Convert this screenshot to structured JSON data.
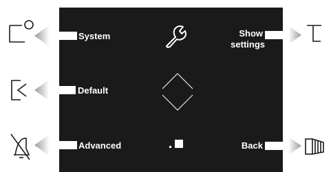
{
  "screen": {
    "background": "#1a1a1a",
    "arrow_color": "#ffffff",
    "left_buttons": [
      {
        "label": "System",
        "icon": "card-corner-circle-icon"
      },
      {
        "label": "Default",
        "icon": "bracket-back-icon"
      },
      {
        "label": "Advanced",
        "icon": "bell-muted-icon"
      }
    ],
    "right_buttons": [
      {
        "label_line1": "Show",
        "label_line2": "settings",
        "icon": "bracket-corner-icon"
      },
      {
        "label": "Back",
        "icon": "cassette-icon"
      }
    ],
    "center_icons": [
      "wrench-icon",
      "diamond-nav-icon",
      "page-indicator-icon"
    ]
  }
}
